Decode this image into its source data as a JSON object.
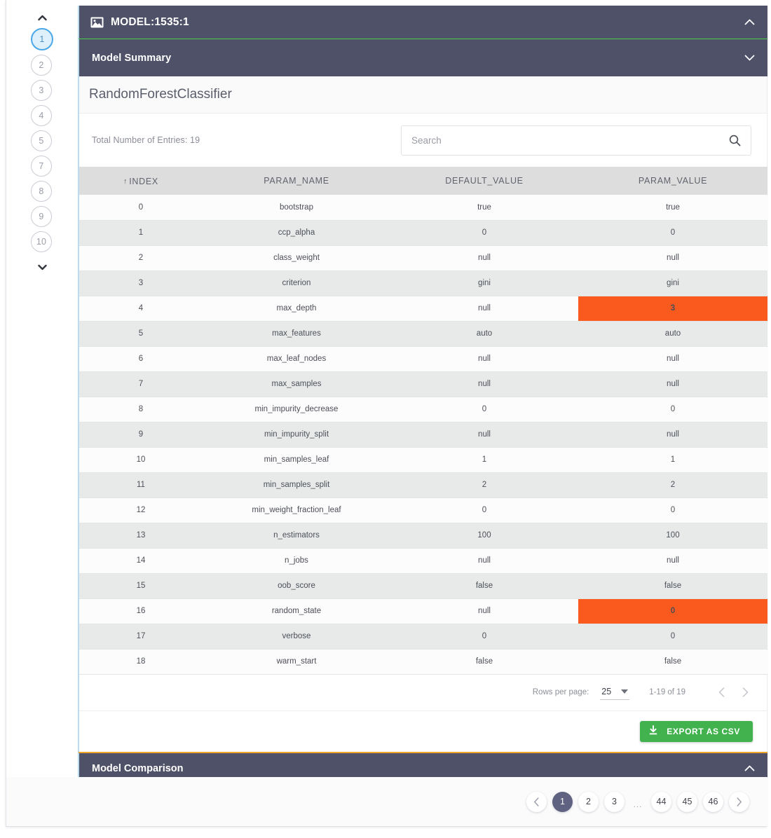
{
  "stepper": {
    "up_arrow": "chevron-up",
    "down_arrow": "chevron-down",
    "items": [
      {
        "label": "1",
        "active": true
      },
      {
        "label": "2",
        "active": false
      },
      {
        "label": "3",
        "active": false
      },
      {
        "label": "4",
        "active": false
      },
      {
        "label": "5",
        "active": false
      },
      {
        "label": "7",
        "active": false
      },
      {
        "label": "8",
        "active": false
      },
      {
        "label": "9",
        "active": false
      },
      {
        "label": "10",
        "active": false
      }
    ]
  },
  "model_bar": {
    "icon": "picture-icon",
    "title": "MODEL:1535:1",
    "chevron": "chevron-up"
  },
  "summary_bar": {
    "title": "Model Summary",
    "chevron": "chevron-down"
  },
  "panel": {
    "title": "RandomForestClassifier",
    "entries_label": "Total Number of Entries: 19",
    "search": {
      "placeholder": "Search",
      "value": "",
      "icon": "search-icon"
    }
  },
  "table": {
    "sort_column": "INDEX",
    "sort_direction": "asc",
    "sort_glyph": "↑",
    "columns": [
      "INDEX",
      "PARAM_NAME",
      "DEFAULT_VALUE",
      "PARAM_VALUE"
    ],
    "rows": [
      {
        "index": "0",
        "param_name": "bootstrap",
        "default_value": "true",
        "param_value": "true",
        "highlight": false
      },
      {
        "index": "1",
        "param_name": "ccp_alpha",
        "default_value": "0",
        "param_value": "0",
        "highlight": false
      },
      {
        "index": "2",
        "param_name": "class_weight",
        "default_value": "null",
        "param_value": "null",
        "highlight": false
      },
      {
        "index": "3",
        "param_name": "criterion",
        "default_value": "gini",
        "param_value": "gini",
        "highlight": false
      },
      {
        "index": "4",
        "param_name": "max_depth",
        "default_value": "null",
        "param_value": "3",
        "highlight": true
      },
      {
        "index": "5",
        "param_name": "max_features",
        "default_value": "auto",
        "param_value": "auto",
        "highlight": false
      },
      {
        "index": "6",
        "param_name": "max_leaf_nodes",
        "default_value": "null",
        "param_value": "null",
        "highlight": false
      },
      {
        "index": "7",
        "param_name": "max_samples",
        "default_value": "null",
        "param_value": "null",
        "highlight": false
      },
      {
        "index": "8",
        "param_name": "min_impurity_decrease",
        "default_value": "0",
        "param_value": "0",
        "highlight": false
      },
      {
        "index": "9",
        "param_name": "min_impurity_split",
        "default_value": "null",
        "param_value": "null",
        "highlight": false
      },
      {
        "index": "10",
        "param_name": "min_samples_leaf",
        "default_value": "1",
        "param_value": "1",
        "highlight": false
      },
      {
        "index": "11",
        "param_name": "min_samples_split",
        "default_value": "2",
        "param_value": "2",
        "highlight": false
      },
      {
        "index": "12",
        "param_name": "min_weight_fraction_leaf",
        "default_value": "0",
        "param_value": "0",
        "highlight": false
      },
      {
        "index": "13",
        "param_name": "n_estimators",
        "default_value": "100",
        "param_value": "100",
        "highlight": false
      },
      {
        "index": "14",
        "param_name": "n_jobs",
        "default_value": "null",
        "param_value": "null",
        "highlight": false
      },
      {
        "index": "15",
        "param_name": "oob_score",
        "default_value": "false",
        "param_value": "false",
        "highlight": false
      },
      {
        "index": "16",
        "param_name": "random_state",
        "default_value": "null",
        "param_value": "0",
        "highlight": true
      },
      {
        "index": "17",
        "param_name": "verbose",
        "default_value": "0",
        "param_value": "0",
        "highlight": false
      },
      {
        "index": "18",
        "param_name": "warm_start",
        "default_value": "false",
        "param_value": "false",
        "highlight": false
      }
    ]
  },
  "table_footer": {
    "rows_per_page_label": "Rows per page:",
    "rows_per_page_value": "25",
    "range_label": "1-19 of 19",
    "prev_icon": "chevron-left-icon",
    "next_icon": "chevron-right-icon"
  },
  "export": {
    "label": "EXPORT AS CSV",
    "icon": "download-icon"
  },
  "comparison_bar": {
    "title": "Model Comparison",
    "chevron": "chevron-up"
  },
  "bottom_pagination": {
    "prev_icon": "chevron-left-icon",
    "next_icon": "chevron-right-icon",
    "ellipsis": "...",
    "pages": [
      {
        "label": "1",
        "active": true
      },
      {
        "label": "2",
        "active": false
      },
      {
        "label": "3",
        "active": false
      },
      {
        "label": "44",
        "active": false
      },
      {
        "label": "45",
        "active": false
      },
      {
        "label": "46",
        "active": false
      }
    ]
  },
  "colors": {
    "bar_dark": "#4e5168",
    "accent_green_line": "#49d14b",
    "highlight_orange": "#fa5a1e",
    "export_green": "#41b24e",
    "comparison_top_border": "#f0a32a",
    "active_step_blue": "#4ba8e8",
    "active_page_slate": "#5f6280"
  }
}
